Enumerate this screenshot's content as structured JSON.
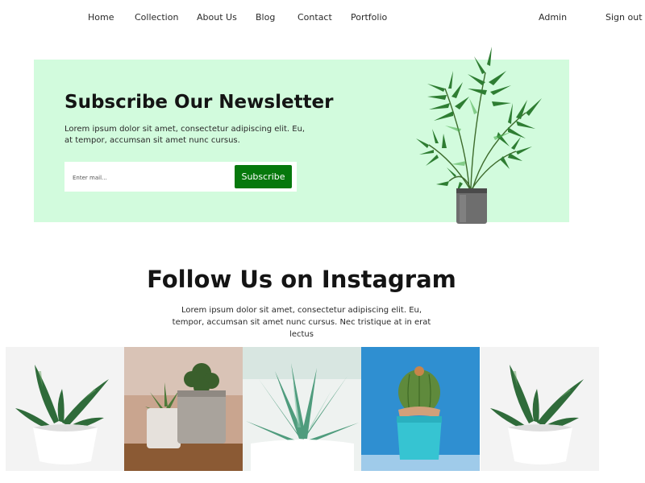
{
  "nav": {
    "items": [
      {
        "label": "Home"
      },
      {
        "label": "Collection"
      },
      {
        "label": "About Us"
      },
      {
        "label": "Blog"
      },
      {
        "label": "Contact"
      },
      {
        "label": "Portfolio"
      }
    ],
    "admin_label": "Admin",
    "signout_label": "Sign out"
  },
  "newsletter": {
    "title": "Subscribe Our Newsletter",
    "text": "Lorem ipsum dolor sit amet, consectetur adipiscing elit. Eu, at tempor, accumsan sit amet nunc cursus.",
    "input_placeholder": "Enter mail...",
    "button_label": "Subscribe",
    "background_color": "#d2fbdd",
    "button_color": "#06780c",
    "image": "potted-palm-plant"
  },
  "instagram": {
    "title": "Follow Us on Instagram",
    "text": "Lorem ipsum dolor sit amet, consectetur adipiscing elit. Eu, tempor, accumsan sit amet nunc cursus. Nec tristique at in erat lectus",
    "photos": [
      {
        "subject": "succulent-white-pot"
      },
      {
        "subject": "succulents-concrete-pots"
      },
      {
        "subject": "aloe-closeup"
      },
      {
        "subject": "cactus-blue-pot"
      },
      {
        "subject": "succulent-white-pot"
      }
    ]
  }
}
